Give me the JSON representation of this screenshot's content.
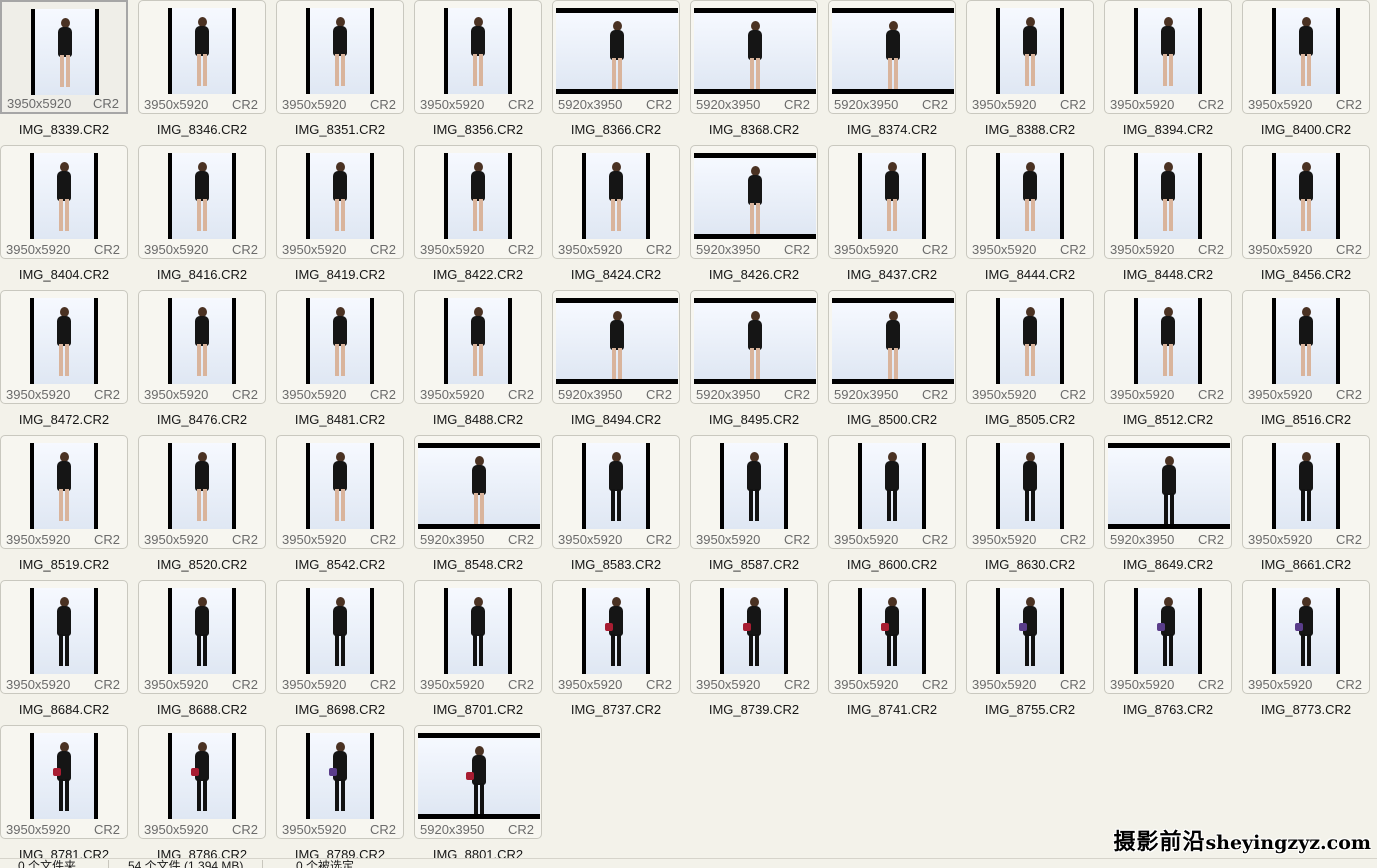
{
  "items": [
    {
      "name": "IMG_8339.CR2",
      "dims": "3950x5920",
      "ext": "CR2",
      "selected": true,
      "wardrobe": "lingerie",
      "bag": ""
    },
    {
      "name": "IMG_8346.CR2",
      "dims": "3950x5920",
      "ext": "CR2",
      "wardrobe": "lingerie",
      "bag": ""
    },
    {
      "name": "IMG_8351.CR2",
      "dims": "3950x5920",
      "ext": "CR2",
      "wardrobe": "lingerie",
      "bag": ""
    },
    {
      "name": "IMG_8356.CR2",
      "dims": "3950x5920",
      "ext": "CR2",
      "wardrobe": "lingerie",
      "bag": ""
    },
    {
      "name": "IMG_8366.CR2",
      "dims": "5920x3950",
      "ext": "CR2",
      "wardrobe": "lingerie",
      "bag": ""
    },
    {
      "name": "IMG_8368.CR2",
      "dims": "5920x3950",
      "ext": "CR2",
      "wardrobe": "lingerie",
      "bag": ""
    },
    {
      "name": "IMG_8374.CR2",
      "dims": "5920x3950",
      "ext": "CR2",
      "wardrobe": "lingerie",
      "bag": ""
    },
    {
      "name": "IMG_8388.CR2",
      "dims": "3950x5920",
      "ext": "CR2",
      "wardrobe": "lingerie",
      "bag": ""
    },
    {
      "name": "IMG_8394.CR2",
      "dims": "3950x5920",
      "ext": "CR2",
      "wardrobe": "lingerie",
      "bag": ""
    },
    {
      "name": "IMG_8400.CR2",
      "dims": "3950x5920",
      "ext": "CR2",
      "wardrobe": "lingerie",
      "bag": ""
    },
    {
      "name": "IMG_8404.CR2",
      "dims": "3950x5920",
      "ext": "CR2",
      "wardrobe": "lingerie",
      "bag": ""
    },
    {
      "name": "IMG_8416.CR2",
      "dims": "3950x5920",
      "ext": "CR2",
      "wardrobe": "lingerie",
      "bag": ""
    },
    {
      "name": "IMG_8419.CR2",
      "dims": "3950x5920",
      "ext": "CR2",
      "wardrobe": "lingerie",
      "bag": ""
    },
    {
      "name": "IMG_8422.CR2",
      "dims": "3950x5920",
      "ext": "CR2",
      "wardrobe": "lingerie",
      "bag": ""
    },
    {
      "name": "IMG_8424.CR2",
      "dims": "3950x5920",
      "ext": "CR2",
      "wardrobe": "lingerie",
      "bag": ""
    },
    {
      "name": "IMG_8426.CR2",
      "dims": "5920x3950",
      "ext": "CR2",
      "wardrobe": "lingerie",
      "bag": ""
    },
    {
      "name": "IMG_8437.CR2",
      "dims": "3950x5920",
      "ext": "CR2",
      "wardrobe": "lingerie",
      "bag": ""
    },
    {
      "name": "IMG_8444.CR2",
      "dims": "3950x5920",
      "ext": "CR2",
      "wardrobe": "lingerie",
      "bag": ""
    },
    {
      "name": "IMG_8448.CR2",
      "dims": "3950x5920",
      "ext": "CR2",
      "wardrobe": "lingerie",
      "bag": ""
    },
    {
      "name": "IMG_8456.CR2",
      "dims": "3950x5920",
      "ext": "CR2",
      "wardrobe": "lingerie",
      "bag": ""
    },
    {
      "name": "IMG_8472.CR2",
      "dims": "3950x5920",
      "ext": "CR2",
      "wardrobe": "lingerie",
      "bag": ""
    },
    {
      "name": "IMG_8476.CR2",
      "dims": "3950x5920",
      "ext": "CR2",
      "wardrobe": "lingerie",
      "bag": ""
    },
    {
      "name": "IMG_8481.CR2",
      "dims": "3950x5920",
      "ext": "CR2",
      "wardrobe": "lingerie",
      "bag": ""
    },
    {
      "name": "IMG_8488.CR2",
      "dims": "3950x5920",
      "ext": "CR2",
      "wardrobe": "lingerie",
      "bag": ""
    },
    {
      "name": "IMG_8494.CR2",
      "dims": "5920x3950",
      "ext": "CR2",
      "wardrobe": "lingerie",
      "bag": ""
    },
    {
      "name": "IMG_8495.CR2",
      "dims": "5920x3950",
      "ext": "CR2",
      "wardrobe": "lingerie",
      "bag": ""
    },
    {
      "name": "IMG_8500.CR2",
      "dims": "5920x3950",
      "ext": "CR2",
      "wardrobe": "lingerie",
      "bag": ""
    },
    {
      "name": "IMG_8505.CR2",
      "dims": "3950x5920",
      "ext": "CR2",
      "wardrobe": "lingerie",
      "bag": ""
    },
    {
      "name": "IMG_8512.CR2",
      "dims": "3950x5920",
      "ext": "CR2",
      "wardrobe": "lingerie",
      "bag": ""
    },
    {
      "name": "IMG_8516.CR2",
      "dims": "3950x5920",
      "ext": "CR2",
      "wardrobe": "lingerie",
      "bag": ""
    },
    {
      "name": "IMG_8519.CR2",
      "dims": "3950x5920",
      "ext": "CR2",
      "wardrobe": "lingerie",
      "bag": ""
    },
    {
      "name": "IMG_8520.CR2",
      "dims": "3950x5920",
      "ext": "CR2",
      "wardrobe": "lingerie",
      "bag": ""
    },
    {
      "name": "IMG_8542.CR2",
      "dims": "3950x5920",
      "ext": "CR2",
      "wardrobe": "lingerie",
      "bag": ""
    },
    {
      "name": "IMG_8548.CR2",
      "dims": "5920x3950",
      "ext": "CR2",
      "wardrobe": "lingerie",
      "bag": ""
    },
    {
      "name": "IMG_8583.CR2",
      "dims": "3950x5920",
      "ext": "CR2",
      "wardrobe": "suit",
      "bag": ""
    },
    {
      "name": "IMG_8587.CR2",
      "dims": "3950x5920",
      "ext": "CR2",
      "wardrobe": "suit",
      "bag": ""
    },
    {
      "name": "IMG_8600.CR2",
      "dims": "3950x5920",
      "ext": "CR2",
      "wardrobe": "suit",
      "bag": ""
    },
    {
      "name": "IMG_8630.CR2",
      "dims": "3950x5920",
      "ext": "CR2",
      "wardrobe": "suit",
      "bag": ""
    },
    {
      "name": "IMG_8649.CR2",
      "dims": "5920x3950",
      "ext": "CR2",
      "wardrobe": "suit",
      "bag": ""
    },
    {
      "name": "IMG_8661.CR2",
      "dims": "3950x5920",
      "ext": "CR2",
      "wardrobe": "suit",
      "bag": ""
    },
    {
      "name": "IMG_8684.CR2",
      "dims": "3950x5920",
      "ext": "CR2",
      "wardrobe": "suit",
      "bag": ""
    },
    {
      "name": "IMG_8688.CR2",
      "dims": "3950x5920",
      "ext": "CR2",
      "wardrobe": "suit",
      "bag": ""
    },
    {
      "name": "IMG_8698.CR2",
      "dims": "3950x5920",
      "ext": "CR2",
      "wardrobe": "suit",
      "bag": ""
    },
    {
      "name": "IMG_8701.CR2",
      "dims": "3950x5920",
      "ext": "CR2",
      "wardrobe": "suit",
      "bag": ""
    },
    {
      "name": "IMG_8737.CR2",
      "dims": "3950x5920",
      "ext": "CR2",
      "wardrobe": "suit",
      "bag": "red"
    },
    {
      "name": "IMG_8739.CR2",
      "dims": "3950x5920",
      "ext": "CR2",
      "wardrobe": "suit",
      "bag": "red"
    },
    {
      "name": "IMG_8741.CR2",
      "dims": "3950x5920",
      "ext": "CR2",
      "wardrobe": "suit",
      "bag": "red"
    },
    {
      "name": "IMG_8755.CR2",
      "dims": "3950x5920",
      "ext": "CR2",
      "wardrobe": "suit",
      "bag": "purple"
    },
    {
      "name": "IMG_8763.CR2",
      "dims": "3950x5920",
      "ext": "CR2",
      "wardrobe": "suit",
      "bag": "purple"
    },
    {
      "name": "IMG_8773.CR2",
      "dims": "3950x5920",
      "ext": "CR2",
      "wardrobe": "suit",
      "bag": "purple"
    },
    {
      "name": "IMG_8781.CR2",
      "dims": "3950x5920",
      "ext": "CR2",
      "wardrobe": "suit",
      "bag": "red"
    },
    {
      "name": "IMG_8786.CR2",
      "dims": "3950x5920",
      "ext": "CR2",
      "wardrobe": "suit",
      "bag": "red"
    },
    {
      "name": "IMG_8789.CR2",
      "dims": "3950x5920",
      "ext": "CR2",
      "wardrobe": "suit",
      "bag": "purple"
    },
    {
      "name": "IMG_8801.CR2",
      "dims": "5920x3950",
      "ext": "CR2",
      "wardrobe": "suit",
      "bag": "red"
    }
  ],
  "status": {
    "folders": "0 个文件夹",
    "files": "54 个文件 (1,394 MB)",
    "selected": "0 个被选定"
  },
  "watermark": {
    "cn": "摄影前沿",
    "url": "sheyingzyz.com"
  },
  "colors": {
    "background": "#f3f2ea",
    "thumb_border": "#c9c8bf",
    "selected_border": "#a6a6a6",
    "label_text": "#151515",
    "meta_text": "#6b6b6b",
    "bag_red": "#a81d32",
    "bag_purple": "#5a3d8a"
  }
}
